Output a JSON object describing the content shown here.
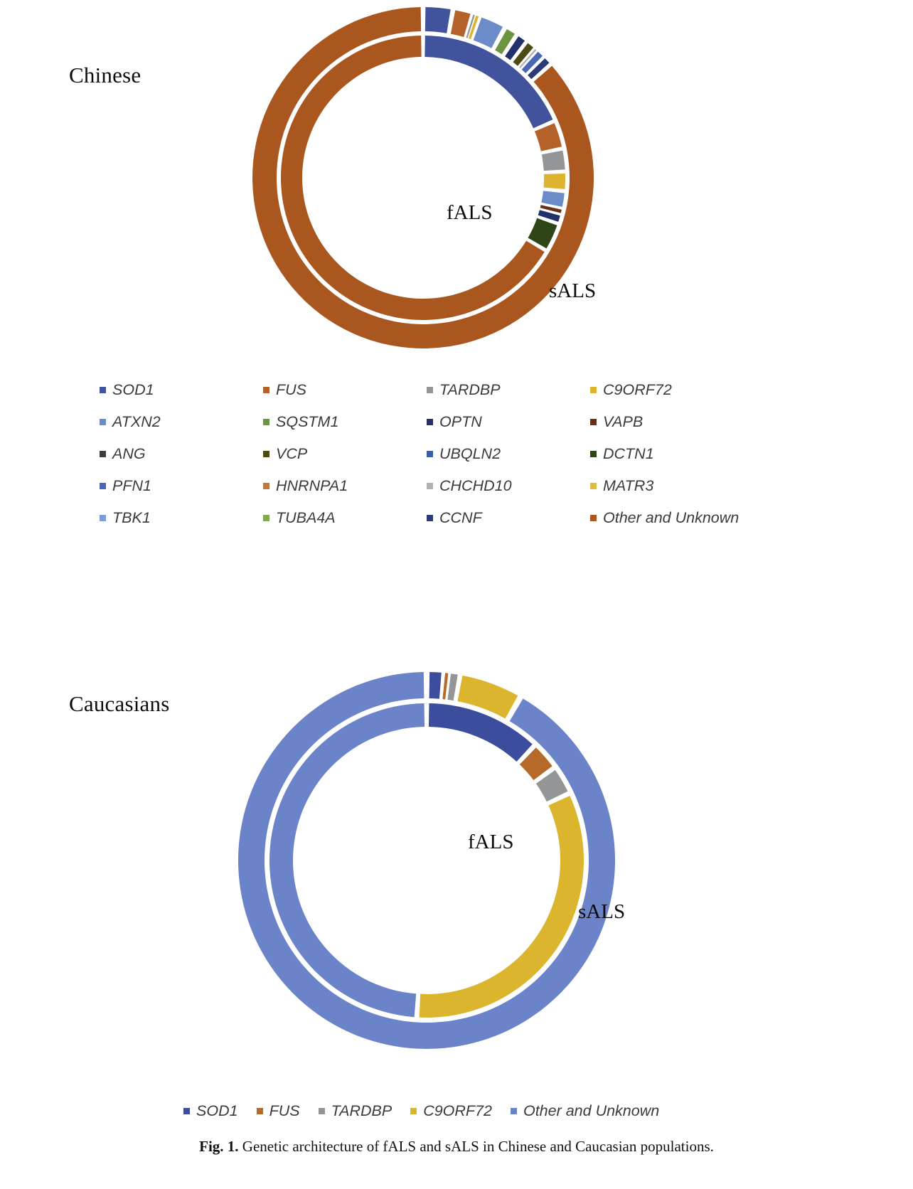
{
  "caption": {
    "label": "Fig. 1.",
    "text": "Genetic architecture of fALS and sALS in Chinese and Caucasian populations."
  },
  "populations": {
    "chinese": "Chinese",
    "caucasians": "Caucasians"
  },
  "ring_labels": {
    "inner": "fALS",
    "outer": "sALS"
  },
  "colors": {
    "SOD1": "#42539e",
    "FUS": "#b5622a",
    "TARDBP": "#939597",
    "C9ORF72": "#ddb430",
    "ATXN2": "#6b8bc9",
    "SQSTM1": "#6b9540",
    "OPTN": "#22306b",
    "VAPB": "#6b2f17",
    "ANG": "#3a3c3d",
    "VCP": "#4d4a13",
    "UBQLN2": "#3d5fa5",
    "DCTN1": "#2f4518",
    "PFN1": "#4a66b5",
    "HNRNPA1": "#c0793c",
    "CHCHD10": "#b0b1b3",
    "MATR3": "#e0bc42",
    "TBK1": "#7d9bd4",
    "TUBA4A": "#7eaa52",
    "CCNF": "#2c3b77",
    "Other and Unknown": "#a9561f",
    "Other and Unknown Caucasian": "#6b83c8",
    "SOD1 Caucasian": "#3c4d9e",
    "FUS Caucasian": "#b5692a",
    "TARDBP Caucasian": "#939597",
    "C9ORF72 Caucasian": "#dcb52f"
  },
  "legend_chinese": [
    {
      "label": "SOD1",
      "color_key": "SOD1"
    },
    {
      "label": "FUS",
      "color_key": "FUS"
    },
    {
      "label": "TARDBP",
      "color_key": "TARDBP"
    },
    {
      "label": "C9ORF72",
      "color_key": "C9ORF72"
    },
    {
      "label": "ATXN2",
      "color_key": "ATXN2"
    },
    {
      "label": "SQSTM1",
      "color_key": "SQSTM1"
    },
    {
      "label": "OPTN",
      "color_key": "OPTN"
    },
    {
      "label": "VAPB",
      "color_key": "VAPB"
    },
    {
      "label": "ANG",
      "color_key": "ANG"
    },
    {
      "label": "VCP",
      "color_key": "VCP"
    },
    {
      "label": "UBQLN2",
      "color_key": "UBQLN2"
    },
    {
      "label": "DCTN1",
      "color_key": "DCTN1"
    },
    {
      "label": "PFN1",
      "color_key": "PFN1"
    },
    {
      "label": "HNRNPA1",
      "color_key": "HNRNPA1"
    },
    {
      "label": "CHCHD10",
      "color_key": "CHCHD10"
    },
    {
      "label": "MATR3",
      "color_key": "MATR3"
    },
    {
      "label": "TBK1",
      "color_key": "TBK1"
    },
    {
      "label": "TUBA4A",
      "color_key": "TUBA4A"
    },
    {
      "label": "CCNF",
      "color_key": "CCNF"
    },
    {
      "label": "Other and Unknown",
      "color_key": "Other and Unknown"
    }
  ],
  "legend_caucasian": [
    {
      "label": "SOD1",
      "color_key": "SOD1 Caucasian"
    },
    {
      "label": "FUS",
      "color_key": "FUS Caucasian"
    },
    {
      "label": "TARDBP",
      "color_key": "TARDBP Caucasian"
    },
    {
      "label": "C9ORF72",
      "color_key": "C9ORF72 Caucasian"
    },
    {
      "label": "Other and Unknown",
      "color_key": "Other and Unknown Caucasian"
    }
  ],
  "chart_data": [
    {
      "type": "pie",
      "title": "Chinese",
      "subtitle": "Genetic architecture of fALS and sALS in Chinese population",
      "legend_position": "below",
      "rings": [
        {
          "name": "fALS",
          "ring": "inner",
          "categories": [
            "SOD1",
            "FUS",
            "TARDBP",
            "C9ORF72",
            "ATXN2",
            "VAPB",
            "OPTN",
            "DCTN1",
            "Other and Unknown"
          ],
          "values": [
            18.5,
            3.2,
            2.6,
            2.2,
            2.0,
            0.6,
            1.1,
            3.3,
            66.5
          ],
          "unit": "percent"
        },
        {
          "name": "sALS",
          "ring": "outer",
          "categories": [
            "SOD1",
            "FUS",
            "TARDBP",
            "C9ORF72",
            "ATXN2",
            "SQSTM1",
            "OPTN",
            "VCP",
            "CHCHD10",
            "PFN1",
            "CCNF",
            "Other and Unknown"
          ],
          "values": [
            2.8,
            1.9,
            0.25,
            0.4,
            2.6,
            1.3,
            1.1,
            1.0,
            0.25,
            0.9,
            0.9,
            86.6
          ],
          "unit": "percent"
        }
      ]
    },
    {
      "type": "pie",
      "title": "Caucasians",
      "subtitle": "Genetic architecture of fALS and sALS in Caucasian population",
      "legend_position": "below",
      "rings": [
        {
          "name": "fALS",
          "ring": "inner",
          "categories": [
            "SOD1",
            "FUS",
            "TARDBP",
            "C9ORF72",
            "Other and Unknown"
          ],
          "values": [
            12.0,
            3.0,
            3.0,
            33.0,
            49.0
          ],
          "unit": "percent"
        },
        {
          "name": "sALS",
          "ring": "outer",
          "categories": [
            "SOD1",
            "FUS",
            "TARDBP",
            "C9ORF72",
            "Other and Unknown"
          ],
          "values": [
            1.5,
            0.4,
            0.9,
            5.5,
            91.7
          ],
          "unit": "percent"
        }
      ]
    }
  ]
}
